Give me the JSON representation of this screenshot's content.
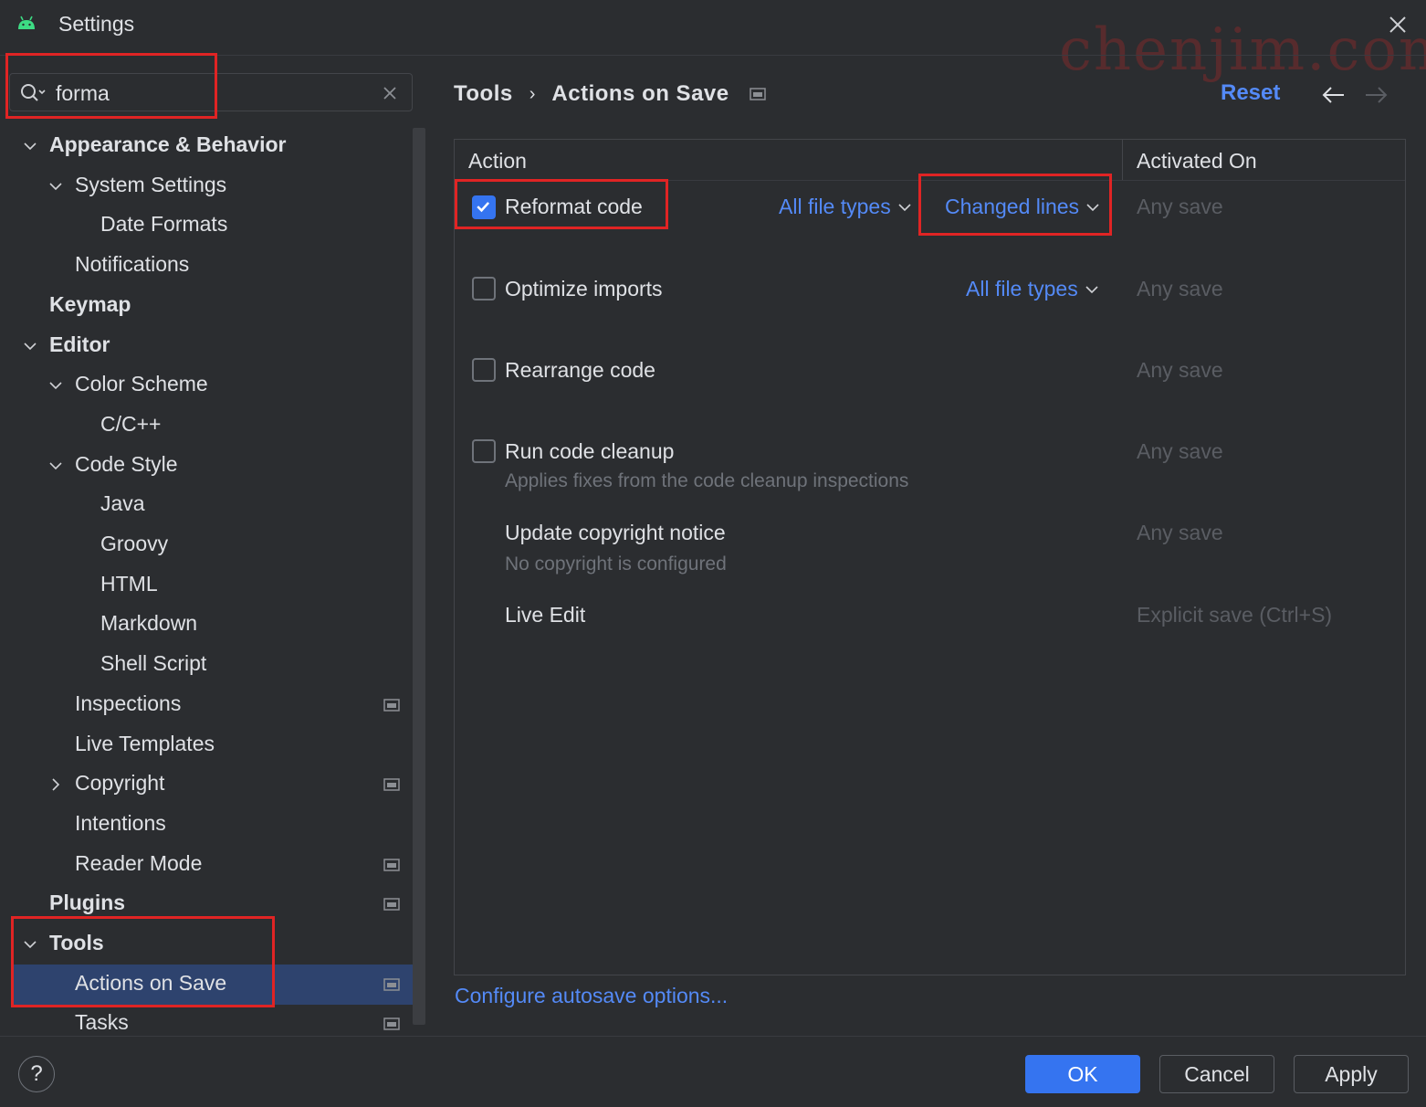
{
  "window": {
    "title": "Settings",
    "watermark": "chenjim.com"
  },
  "search": {
    "value": "forma",
    "placeholder": ""
  },
  "sidebar": {
    "items": [
      {
        "label": "Appearance & Behavior",
        "level": 0,
        "expanded": true,
        "bold": true
      },
      {
        "label": "System Settings",
        "level": 1,
        "expanded": true
      },
      {
        "label": "Date Formats",
        "level": 2
      },
      {
        "label": "Notifications",
        "level": 1
      },
      {
        "label": "Keymap",
        "level": 0,
        "bold": true
      },
      {
        "label": "Editor",
        "level": 0,
        "expanded": true,
        "bold": true
      },
      {
        "label": "Color Scheme",
        "level": 1,
        "expanded": true
      },
      {
        "label": "C/C++",
        "level": 2
      },
      {
        "label": "Code Style",
        "level": 1,
        "expanded": true
      },
      {
        "label": "Java",
        "level": 2
      },
      {
        "label": "Groovy",
        "level": 2
      },
      {
        "label": "HTML",
        "level": 2
      },
      {
        "label": "Markdown",
        "level": 2
      },
      {
        "label": "Shell Script",
        "level": 2
      },
      {
        "label": "Inspections",
        "level": 1,
        "project_icon": true
      },
      {
        "label": "Live Templates",
        "level": 1
      },
      {
        "label": "Copyright",
        "level": 1,
        "collapsed": true,
        "project_icon": true
      },
      {
        "label": "Intentions",
        "level": 1
      },
      {
        "label": "Reader Mode",
        "level": 1,
        "project_icon": true
      },
      {
        "label": "Plugins",
        "level": 0,
        "bold": true,
        "project_icon": true
      },
      {
        "label": "Tools",
        "level": 0,
        "expanded": true,
        "bold": true
      },
      {
        "label": "Actions on Save",
        "level": 1,
        "selected": true,
        "project_icon": true
      },
      {
        "label": "Tasks",
        "level": 1,
        "project_icon": true
      }
    ]
  },
  "breadcrumb": {
    "parent": "Tools",
    "separator": "›",
    "current": "Actions on Save"
  },
  "header": {
    "reset_label": "Reset"
  },
  "table": {
    "col_action": "Action",
    "col_activated": "Activated On",
    "rows": [
      {
        "label": "Reformat code",
        "checked": true,
        "has_checkbox": true,
        "file_types": "All file types",
        "scope": "Changed lines",
        "activated_on": "Any save"
      },
      {
        "label": "Optimize imports",
        "checked": false,
        "has_checkbox": true,
        "file_types": "All file types",
        "activated_on": "Any save"
      },
      {
        "label": "Rearrange code",
        "checked": false,
        "has_checkbox": true,
        "activated_on": "Any save"
      },
      {
        "label": "Run code cleanup",
        "checked": false,
        "has_checkbox": true,
        "description": "Applies fixes from the code cleanup inspections",
        "activated_on": "Any save"
      },
      {
        "label": "Update copyright notice",
        "has_checkbox": false,
        "description": "No copyright is configured",
        "activated_on": "Any save"
      },
      {
        "label": "Live Edit",
        "has_checkbox": false,
        "activated_on": "Explicit save (Ctrl+S)"
      }
    ]
  },
  "footer": {
    "configure_link": "Configure autosave options...",
    "help_label": "?",
    "ok_label": "OK",
    "cancel_label": "Cancel",
    "apply_label": "Apply"
  },
  "colors": {
    "background": "#2b2d30",
    "accent": "#3574f0",
    "link": "#548af7",
    "selection": "#2e436e",
    "annotation": "#e02424",
    "muted_text": "#5a5d63"
  },
  "icons": {
    "app": "android-icon",
    "close": "close-icon",
    "search": "search-icon",
    "clear": "clear-icon",
    "project_scope": "project-scope-icon",
    "back": "arrow-left-icon",
    "forward": "arrow-right-icon"
  }
}
